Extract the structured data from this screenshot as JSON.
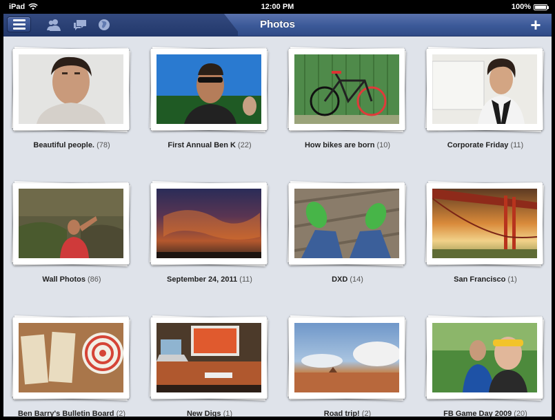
{
  "status": {
    "carrier": "iPad",
    "time": "12:00 PM",
    "battery": "100%"
  },
  "nav": {
    "title": "Photos",
    "add": "+"
  },
  "albums": [
    {
      "name": "Beautiful people.",
      "count": "(78)"
    },
    {
      "name": "First Annual Ben K",
      "count": "(22)"
    },
    {
      "name": "How bikes are born",
      "count": "(10)"
    },
    {
      "name": "Corporate Friday",
      "count": "(11)"
    },
    {
      "name": "Wall Photos",
      "count": "(86)"
    },
    {
      "name": "September 24, 2011",
      "count": "(11)"
    },
    {
      "name": "DXD",
      "count": "(14)"
    },
    {
      "name": "San Francisco",
      "count": "(1)"
    },
    {
      "name": "Ben Barry's Bulletin Board",
      "count": "(2)"
    },
    {
      "name": "New Digs",
      "count": "(1)"
    },
    {
      "name": "Road trip!",
      "count": "(2)"
    },
    {
      "name": "FB Game Day 2009",
      "count": "(20)"
    }
  ]
}
